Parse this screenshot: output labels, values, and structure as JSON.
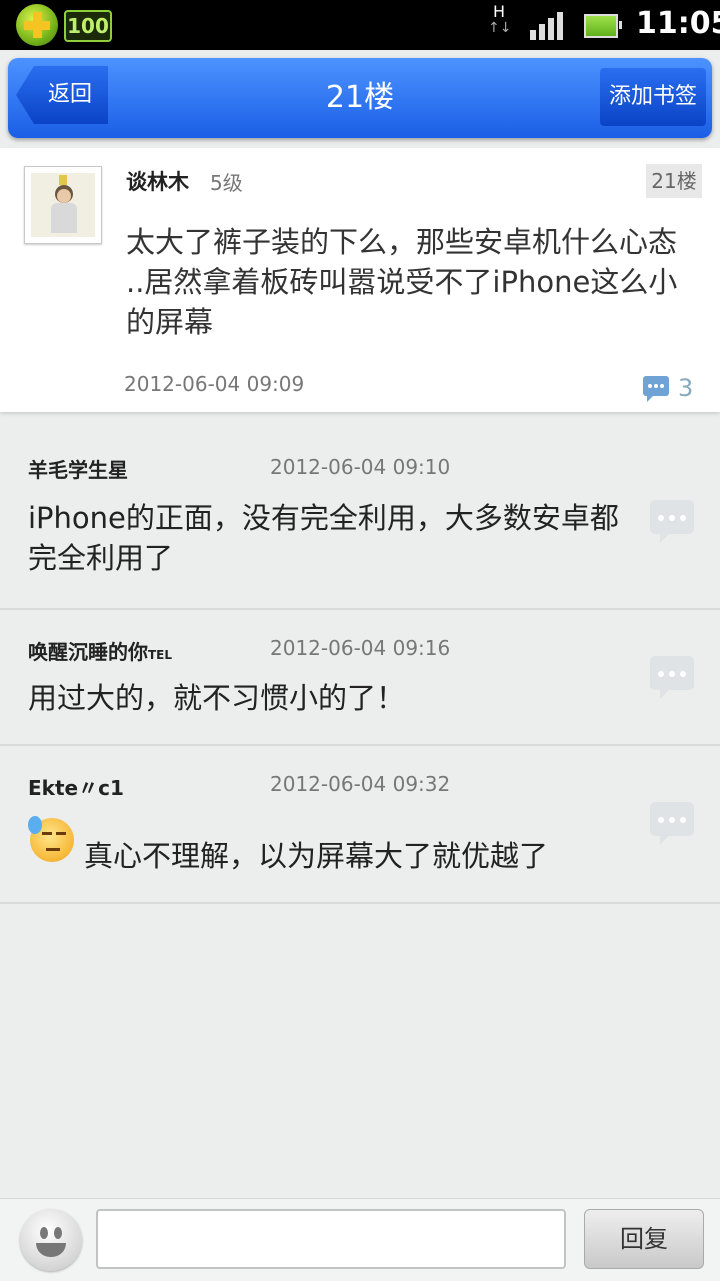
{
  "status_bar": {
    "network": "H",
    "network_arrows": "↑↓",
    "app_badge": "100",
    "time": "11:05"
  },
  "header": {
    "back_label": "返回",
    "title": "21楼",
    "bookmark_label": "添加书签"
  },
  "post": {
    "author": "谈林木",
    "level": "5级",
    "floor_badge": "21楼",
    "content": "太大了裤子装的下么，那些安卓机什么心态 ..居然拿着板砖叫嚣说受不了iPhone这么小的屏幕",
    "time": "2012-06-04 09:09",
    "comment_count": "3"
  },
  "replies": [
    {
      "author": "羊毛学生星",
      "author_suffix": "",
      "time": "2012-06-04 09:10",
      "text": "iPhone的正面，没有完全利用，大多数安卓都完全利用了"
    },
    {
      "author": "唤醒沉睡的你",
      "author_suffix": "TEL",
      "time": "2012-06-04 09:16",
      "text": "用过大的，就不习惯小的了！"
    },
    {
      "author": "Ekte〃c1",
      "author_suffix": "",
      "time": "2012-06-04 09:32",
      "text": "真心不理解，以为屏幕大了就优越了"
    }
  ],
  "bottom_bar": {
    "input_value": "",
    "reply_label": "回复"
  },
  "colors": {
    "header_blue": "#1a5ee6",
    "background": "#eceeee"
  },
  "icons": [
    "add-plus-icon",
    "signal-icon",
    "battery-icon",
    "comment-icon",
    "emoji-icon",
    "smiley-icon"
  ]
}
